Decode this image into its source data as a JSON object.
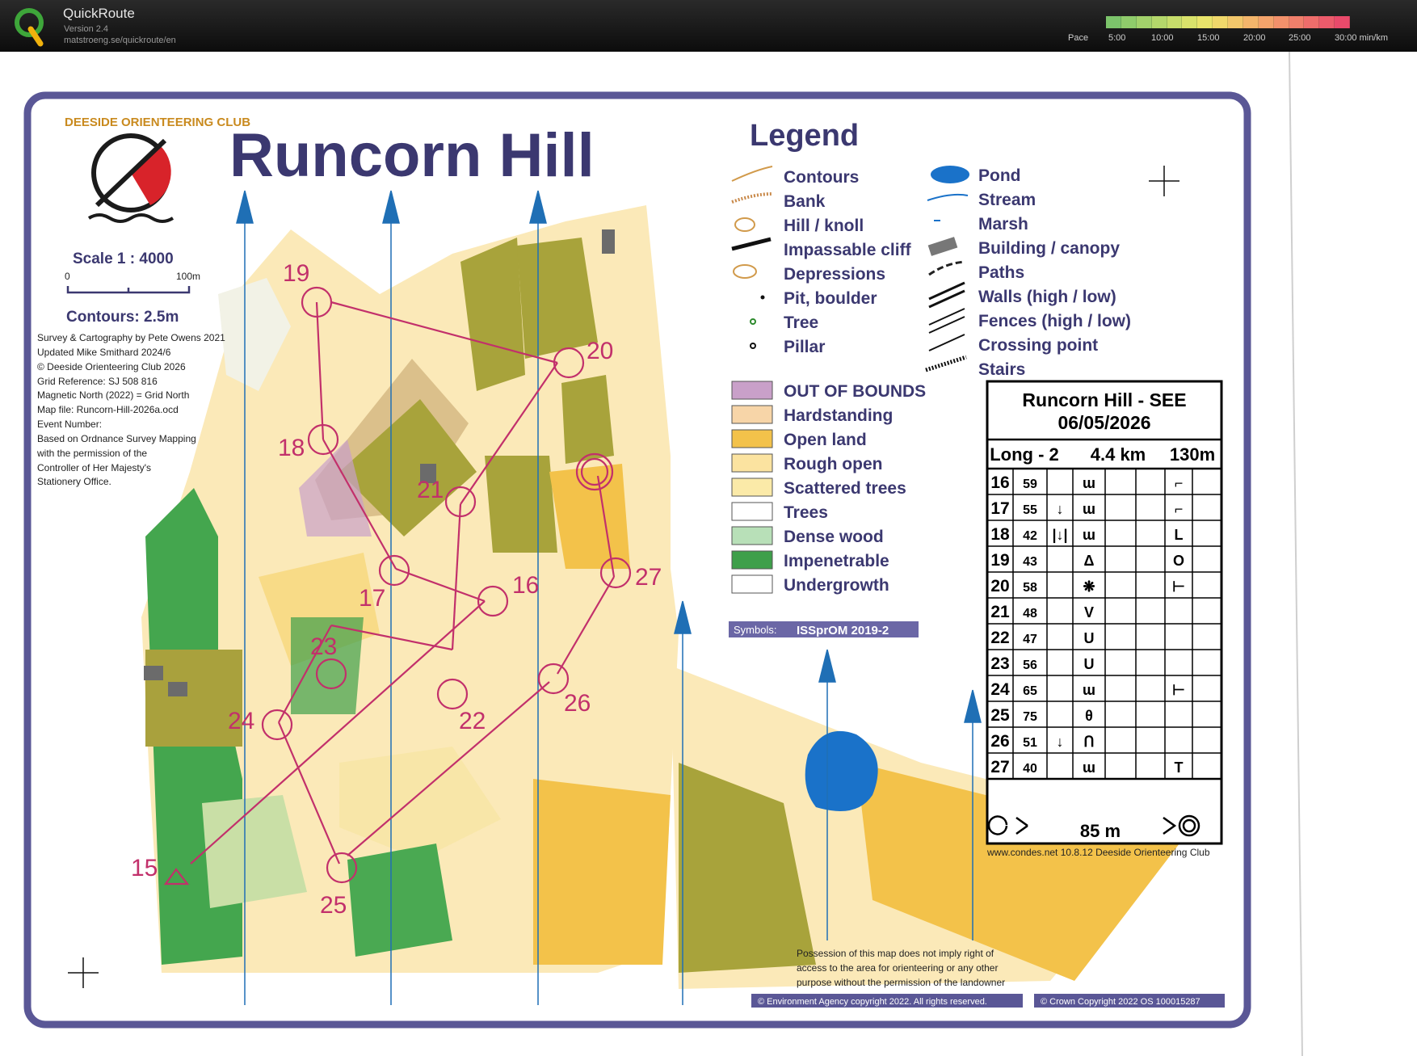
{
  "app": {
    "title": "QuickRoute",
    "version": "Version 2.4",
    "url": "matstroeng.se/quickroute/en",
    "pace_label": "Pace",
    "pace_ticks": [
      "5:00",
      "10:00",
      "15:00",
      "20:00",
      "25:00",
      "30:00 min/km"
    ]
  },
  "map": {
    "title": "Runcorn Hill",
    "club": "DEESIDE ORIENTEERING CLUB",
    "scale": "Scale 1 : 4000",
    "scale_zero": "0",
    "scale_max": "100m",
    "contours": "Contours: 2.5m",
    "credits": [
      "Survey & Cartography by Pete Owens 2021",
      "Updated Mike Smithard 2024/6",
      "© Deeside Orienteering Club 2026",
      "Grid Reference: SJ 508 816",
      "Magnetic North (2022) = Grid North",
      "Map file: Runcorn-Hill-2026a.ocd",
      "Event Number:",
      "Based on Ordnance Survey Mapping",
      "with the permission of the",
      "Controller of Her Majesty's",
      "Stationery Office."
    ],
    "legend_title": "Legend",
    "legend_left": [
      "Contours",
      "Bank",
      "Hill / knoll",
      "Impassable cliff",
      "Depressions",
      "Pit, boulder",
      "Tree",
      "Pillar"
    ],
    "legend_right": [
      "Pond",
      "Stream",
      "Marsh",
      "Building / canopy",
      "Paths",
      "Walls (high / low)",
      "Fences (high / low)",
      "Crossing point",
      "Stairs"
    ],
    "legend_areas": [
      "OUT OF BOUNDS",
      "Hardstanding",
      "Open land",
      "Rough open",
      "Scattered trees",
      "Trees",
      "Dense wood",
      "Impenetrable",
      "Undergrowth"
    ],
    "symbols_label": "Symbols:",
    "symbols_value": "ISSprOM 2019-2",
    "controls": [
      "15",
      "16",
      "17",
      "18",
      "19",
      "20",
      "21",
      "22",
      "23",
      "24",
      "25",
      "26",
      "27"
    ],
    "possession": [
      "Possession of this map does not imply right of",
      "access to the area for orienteering or any other",
      "purpose without the permission of the landowner"
    ],
    "copyright_ea": "© Environment Agency copyright 2022. All rights reserved.",
    "copyright_crown": "© Crown Copyright 2022 OS 100015287",
    "condes": "www.condes.net 10.8.12 Deeside Orienteering Club"
  },
  "description_sheet": {
    "event": "Runcorn Hill - SEE",
    "date": "06/05/2026",
    "course": "Long - 2",
    "length": "4.4 km",
    "climb": "130m",
    "rows": [
      {
        "num": "16",
        "code": "59",
        "c": "",
        "d": "ɯ",
        "g": "⌐"
      },
      {
        "num": "17",
        "code": "55",
        "c": "↓",
        "d": "ɯ",
        "g": "⌐"
      },
      {
        "num": "18",
        "code": "42",
        "c": "|↓|",
        "d": "ɯ",
        "g": "L"
      },
      {
        "num": "19",
        "code": "43",
        "c": "",
        "d": "Δ",
        "g": "O"
      },
      {
        "num": "20",
        "code": "58",
        "c": "",
        "d": "❋",
        "g": "⊢"
      },
      {
        "num": "21",
        "code": "48",
        "c": "",
        "d": "V",
        "g": ""
      },
      {
        "num": "22",
        "code": "47",
        "c": "",
        "d": "U",
        "g": ""
      },
      {
        "num": "23",
        "code": "56",
        "c": "",
        "d": "U",
        "g": ""
      },
      {
        "num": "24",
        "code": "65",
        "c": "",
        "d": "ɯ",
        "g": "⊢"
      },
      {
        "num": "25",
        "code": "75",
        "c": "",
        "d": "θ",
        "g": ""
      },
      {
        "num": "26",
        "code": "51",
        "c": "↓",
        "d": "Ո",
        "g": ""
      },
      {
        "num": "27",
        "code": "40",
        "c": "",
        "d": "ɯ",
        "g": "T"
      }
    ],
    "finish": "85 m"
  },
  "colors": {
    "brand_purple": "#3b3870",
    "course_magenta": "#c2306b",
    "open_yellow": "#f3c24a",
    "rough_open": "#fbe3a0",
    "green": "#3e9f4a",
    "olive": "#a9a13d",
    "pond_blue": "#1a72c9"
  }
}
